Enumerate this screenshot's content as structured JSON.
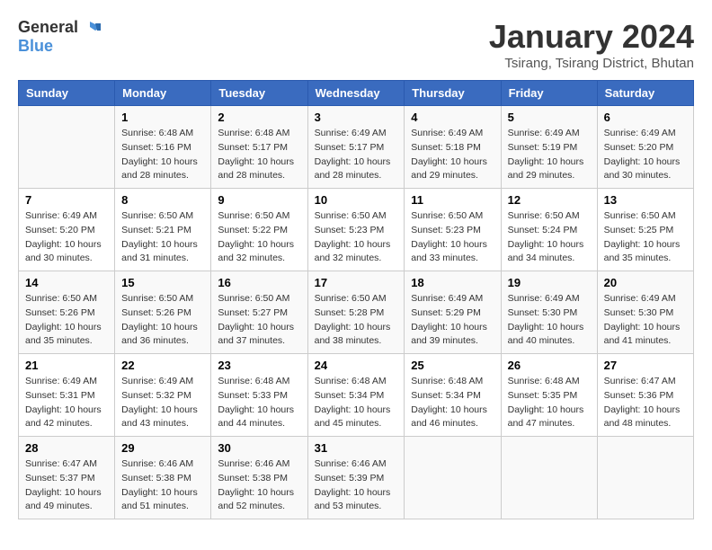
{
  "header": {
    "logo_line1": "General",
    "logo_line2": "Blue",
    "month_year": "January 2024",
    "location": "Tsirang, Tsirang District, Bhutan"
  },
  "columns": [
    "Sunday",
    "Monday",
    "Tuesday",
    "Wednesday",
    "Thursday",
    "Friday",
    "Saturday"
  ],
  "weeks": [
    {
      "days": [
        {
          "number": "",
          "info": ""
        },
        {
          "number": "1",
          "info": "Sunrise: 6:48 AM\nSunset: 5:16 PM\nDaylight: 10 hours\nand 28 minutes."
        },
        {
          "number": "2",
          "info": "Sunrise: 6:48 AM\nSunset: 5:17 PM\nDaylight: 10 hours\nand 28 minutes."
        },
        {
          "number": "3",
          "info": "Sunrise: 6:49 AM\nSunset: 5:17 PM\nDaylight: 10 hours\nand 28 minutes."
        },
        {
          "number": "4",
          "info": "Sunrise: 6:49 AM\nSunset: 5:18 PM\nDaylight: 10 hours\nand 29 minutes."
        },
        {
          "number": "5",
          "info": "Sunrise: 6:49 AM\nSunset: 5:19 PM\nDaylight: 10 hours\nand 29 minutes."
        },
        {
          "number": "6",
          "info": "Sunrise: 6:49 AM\nSunset: 5:20 PM\nDaylight: 10 hours\nand 30 minutes."
        }
      ]
    },
    {
      "days": [
        {
          "number": "7",
          "info": "Sunrise: 6:49 AM\nSunset: 5:20 PM\nDaylight: 10 hours\nand 30 minutes."
        },
        {
          "number": "8",
          "info": "Sunrise: 6:50 AM\nSunset: 5:21 PM\nDaylight: 10 hours\nand 31 minutes."
        },
        {
          "number": "9",
          "info": "Sunrise: 6:50 AM\nSunset: 5:22 PM\nDaylight: 10 hours\nand 32 minutes."
        },
        {
          "number": "10",
          "info": "Sunrise: 6:50 AM\nSunset: 5:23 PM\nDaylight: 10 hours\nand 32 minutes."
        },
        {
          "number": "11",
          "info": "Sunrise: 6:50 AM\nSunset: 5:23 PM\nDaylight: 10 hours\nand 33 minutes."
        },
        {
          "number": "12",
          "info": "Sunrise: 6:50 AM\nSunset: 5:24 PM\nDaylight: 10 hours\nand 34 minutes."
        },
        {
          "number": "13",
          "info": "Sunrise: 6:50 AM\nSunset: 5:25 PM\nDaylight: 10 hours\nand 35 minutes."
        }
      ]
    },
    {
      "days": [
        {
          "number": "14",
          "info": "Sunrise: 6:50 AM\nSunset: 5:26 PM\nDaylight: 10 hours\nand 35 minutes."
        },
        {
          "number": "15",
          "info": "Sunrise: 6:50 AM\nSunset: 5:26 PM\nDaylight: 10 hours\nand 36 minutes."
        },
        {
          "number": "16",
          "info": "Sunrise: 6:50 AM\nSunset: 5:27 PM\nDaylight: 10 hours\nand 37 minutes."
        },
        {
          "number": "17",
          "info": "Sunrise: 6:50 AM\nSunset: 5:28 PM\nDaylight: 10 hours\nand 38 minutes."
        },
        {
          "number": "18",
          "info": "Sunrise: 6:49 AM\nSunset: 5:29 PM\nDaylight: 10 hours\nand 39 minutes."
        },
        {
          "number": "19",
          "info": "Sunrise: 6:49 AM\nSunset: 5:30 PM\nDaylight: 10 hours\nand 40 minutes."
        },
        {
          "number": "20",
          "info": "Sunrise: 6:49 AM\nSunset: 5:30 PM\nDaylight: 10 hours\nand 41 minutes."
        }
      ]
    },
    {
      "days": [
        {
          "number": "21",
          "info": "Sunrise: 6:49 AM\nSunset: 5:31 PM\nDaylight: 10 hours\nand 42 minutes."
        },
        {
          "number": "22",
          "info": "Sunrise: 6:49 AM\nSunset: 5:32 PM\nDaylight: 10 hours\nand 43 minutes."
        },
        {
          "number": "23",
          "info": "Sunrise: 6:48 AM\nSunset: 5:33 PM\nDaylight: 10 hours\nand 44 minutes."
        },
        {
          "number": "24",
          "info": "Sunrise: 6:48 AM\nSunset: 5:34 PM\nDaylight: 10 hours\nand 45 minutes."
        },
        {
          "number": "25",
          "info": "Sunrise: 6:48 AM\nSunset: 5:34 PM\nDaylight: 10 hours\nand 46 minutes."
        },
        {
          "number": "26",
          "info": "Sunrise: 6:48 AM\nSunset: 5:35 PM\nDaylight: 10 hours\nand 47 minutes."
        },
        {
          "number": "27",
          "info": "Sunrise: 6:47 AM\nSunset: 5:36 PM\nDaylight: 10 hours\nand 48 minutes."
        }
      ]
    },
    {
      "days": [
        {
          "number": "28",
          "info": "Sunrise: 6:47 AM\nSunset: 5:37 PM\nDaylight: 10 hours\nand 49 minutes."
        },
        {
          "number": "29",
          "info": "Sunrise: 6:46 AM\nSunset: 5:38 PM\nDaylight: 10 hours\nand 51 minutes."
        },
        {
          "number": "30",
          "info": "Sunrise: 6:46 AM\nSunset: 5:38 PM\nDaylight: 10 hours\nand 52 minutes."
        },
        {
          "number": "31",
          "info": "Sunrise: 6:46 AM\nSunset: 5:39 PM\nDaylight: 10 hours\nand 53 minutes."
        },
        {
          "number": "",
          "info": ""
        },
        {
          "number": "",
          "info": ""
        },
        {
          "number": "",
          "info": ""
        }
      ]
    }
  ]
}
